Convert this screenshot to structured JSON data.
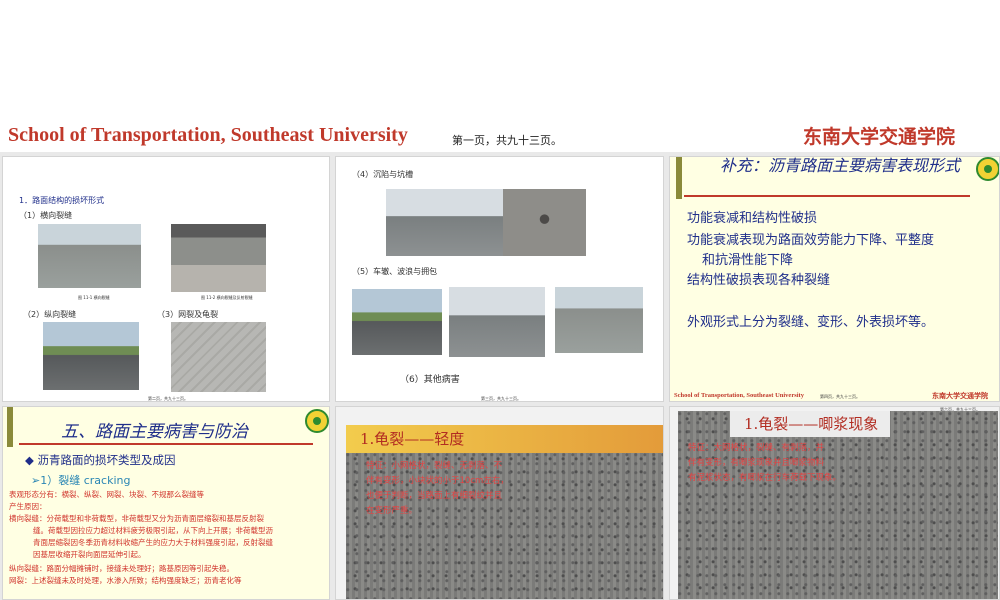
{
  "header": {
    "school_en": "School  of Transportation, Southeast University",
    "page_info": "第一页，共九十三页。",
    "school_cn": "东南大学交通学院"
  },
  "slide1": {
    "heading": "1．路面结构的损坏形式",
    "item1": "（1）横向裂缝",
    "cap1": "图 11-1 横向裂缝",
    "cap2": "图 11-2 横向裂缝及反射裂缝",
    "item2": "（2）纵向裂缝",
    "item3": "（3）网裂及龟裂",
    "footer": "第二页，共九十三页。"
  },
  "slide2": {
    "item4": "（4）沉陷与坑槽",
    "item5": "（5）车辙、波浪与拥包",
    "item6": "（6）其他病害",
    "footer": "第三页，共九十三页。"
  },
  "slide3": {
    "title": "补充：沥青路面主要病害表现形式",
    "lines": [
      "功能衰减和结构性破损",
      "功能衰减表现为路面效劳能力下降、平整度",
      "和抗滑性能下降",
      "结构性破损表现各种裂缝",
      "外观形式上分为裂缝、变形、外表损坏等。"
    ],
    "footer_en": "School  of Transportation, Southeast University",
    "footer_page": "第四页，共九十三页。",
    "footer_cn": "东南大学交通学院"
  },
  "slide4": {
    "title": "五、路面主要病害与防治",
    "bullet": "◆ 沥青路面的损坏类型及成因",
    "sub": "➢1）裂缝   cracking",
    "lines": [
      "表观形态分有：横裂、纵裂、网裂、块裂、不规那么裂缝等",
      "产生原因：",
      "横向裂缝：分荷载型和非荷载型，非荷载型又分为沥青面层缩裂和基层反射裂",
      "缝。荷载型因拉应力超过材料疲劳极限引起，从下向上开展；非荷载型沥",
      "青面层缩裂因冬季沥青材料收缩产生的应力大于材料强度引起，反射裂缝",
      "因基层收缩开裂向面层延伸引起。",
      "纵向裂缝：路面分幅摊铺时，接缝未处理好；路基原因等引起失稳。",
      "网裂：上述裂缝未及时处理，水渗入所致；结构强度缺乏；沥青老化等"
    ]
  },
  "slide5": {
    "title": "1.龟裂——轻度",
    "overlay": [
      "特征：小网格状，裂缝、无剥落、不",
      "伴有变形，小块状的小于10cm左右，",
      "也便于判断，当路面上有细裂纹并且",
      "在变形严重。"
    ]
  },
  "slide6": {
    "title": "1.龟裂——唧浆现象",
    "page_label": "第六页，共九十三页。",
    "overlay": [
      "特征：大网格状，裂缝、有剥落，并",
      "伴有变形，有唧浆现象并且唧浆物料",
      "有泥浆状态，有唧浆在行车荷载下现象。"
    ]
  }
}
